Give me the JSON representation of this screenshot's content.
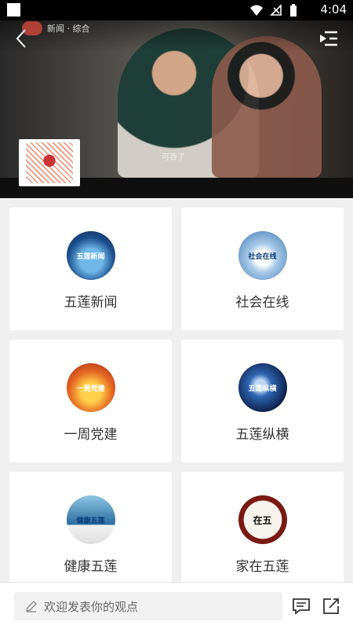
{
  "status_bar": {
    "time": "4:04"
  },
  "video": {
    "channel_text": "新闻 · 综合",
    "subtitle": "可吞了"
  },
  "tiles": [
    {
      "label": "五莲新闻",
      "thumb_text": "五莲新闻"
    },
    {
      "label": "社会在线",
      "thumb_text": "社会在线"
    },
    {
      "label": "一周党建",
      "thumb_text": "一周党建"
    },
    {
      "label": "五莲纵横",
      "thumb_text": "五莲纵横"
    },
    {
      "label": "健康五莲",
      "thumb_text": "健康五莲"
    },
    {
      "label": "家在五莲",
      "thumb_text": "在五"
    }
  ],
  "bottom_bar": {
    "comment_placeholder": "欢迎发表你的观点"
  },
  "colors": {
    "tile_bg": "#ffffff",
    "page_bg": "#efefef",
    "text": "#333333"
  }
}
